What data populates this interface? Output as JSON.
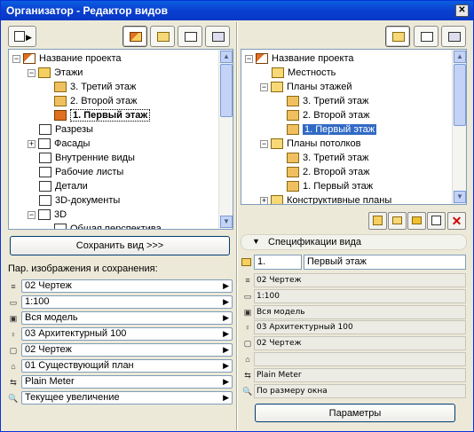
{
  "window": {
    "title": "Организатор - Редактор видов",
    "close": "✕"
  },
  "left": {
    "tree": [
      {
        "label": "Название проекта",
        "icon": "house-icon",
        "expander": "−",
        "level": 0
      },
      {
        "label": "Этажи",
        "icon": "stories-folder-icon",
        "expander": "−",
        "level": 1
      },
      {
        "label": "3. Третий этаж",
        "icon": "story-icon",
        "level": 2
      },
      {
        "label": "2. Второй этаж",
        "icon": "story-icon",
        "level": 2
      },
      {
        "label": "1. Первый этаж",
        "icon": "story-icon",
        "level": 2,
        "selected": true
      },
      {
        "label": "Разрезы",
        "icon": "section-icon",
        "level": 1
      },
      {
        "label": "Фасады",
        "icon": "elevation-icon",
        "expander": "+",
        "level": 1
      },
      {
        "label": "Внутренние виды",
        "icon": "interior-icon",
        "level": 1
      },
      {
        "label": "Рабочие листы",
        "icon": "worksheet-icon",
        "level": 1
      },
      {
        "label": "Детали",
        "icon": "detail-icon",
        "level": 1
      },
      {
        "label": "3D-документы",
        "icon": "3d-doc-icon",
        "level": 1
      },
      {
        "label": "3D",
        "icon": "3d-icon",
        "expander": "−",
        "level": 1
      },
      {
        "label": "Общая перспектива",
        "icon": "camera-icon",
        "level": 2
      }
    ],
    "save_button": "Сохранить вид >>>",
    "params_label": "Пар. изображения и сохранения:",
    "params": [
      {
        "icon": "layers-icon",
        "value": "02 Чертеж"
      },
      {
        "icon": "scale-icon",
        "value": "1:100"
      },
      {
        "icon": "model-icon",
        "value": "Вся модель"
      },
      {
        "icon": "pen-icon",
        "value": "03 Архитектурный 100"
      },
      {
        "icon": "view-options-icon",
        "value": "02 Чертеж"
      },
      {
        "icon": "renovation-icon",
        "value": "01 Существующий план"
      },
      {
        "icon": "dimension-icon",
        "value": "Plain Meter"
      },
      {
        "icon": "zoom-icon",
        "value": "Текущее увеличение"
      }
    ]
  },
  "right": {
    "tree": [
      {
        "label": "Название проекта",
        "icon": "house-icon",
        "expander": "−",
        "level": 0
      },
      {
        "label": "Местность",
        "icon": "folder-icon",
        "level": 1
      },
      {
        "label": "Планы этажей",
        "icon": "folder-icon",
        "expander": "−",
        "level": 1
      },
      {
        "label": "3. Третий этаж",
        "icon": "story-icon",
        "level": 2
      },
      {
        "label": "2. Второй этаж",
        "icon": "story-icon",
        "level": 2
      },
      {
        "label": "1. Первый этаж",
        "icon": "story-icon",
        "level": 2,
        "highlighted": true
      },
      {
        "label": "Планы потолков",
        "icon": "folder-icon",
        "expander": "−",
        "level": 1
      },
      {
        "label": "3. Третий этаж",
        "icon": "story-icon",
        "level": 2
      },
      {
        "label": "2. Второй этаж",
        "icon": "story-icon",
        "level": 2
      },
      {
        "label": "1. Первый этаж",
        "icon": "story-icon",
        "level": 2
      },
      {
        "label": "Конструктивные планы",
        "icon": "folder-icon",
        "expander": "+",
        "level": 1
      }
    ],
    "spec_header": "Спецификации вида",
    "spec_id": "1.",
    "spec_name": "Первый этаж",
    "specs": [
      {
        "icon": "layers-icon",
        "value": "02 Чертеж"
      },
      {
        "icon": "scale-icon",
        "value": "1:100"
      },
      {
        "icon": "model-icon",
        "value": "Вся модель"
      },
      {
        "icon": "pen-icon",
        "value": "03 Архитектурный 100"
      },
      {
        "icon": "view-options-icon",
        "value": "02 Чертеж"
      },
      {
        "icon": "renovation-icon",
        "value": ""
      },
      {
        "icon": "dimension-icon",
        "value": "Plain Meter"
      },
      {
        "icon": "zoom-icon",
        "value": "По размеру окна"
      }
    ],
    "params_button": "Параметры"
  },
  "colors": {
    "title_bar": "#0a4fd8",
    "selection": "#316ac5",
    "delete": "#cc0000"
  }
}
